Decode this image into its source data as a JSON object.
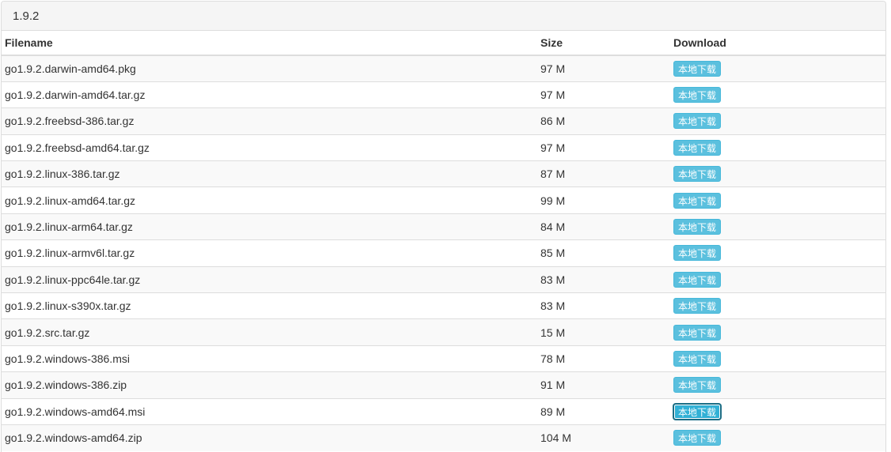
{
  "panel": {
    "title": "1.9.2"
  },
  "table": {
    "headers": {
      "filename": "Filename",
      "size": "Size",
      "download": "Download"
    },
    "rows": [
      {
        "filename": "go1.9.2.darwin-amd64.pkg",
        "size": "97 M",
        "download": "本地下载"
      },
      {
        "filename": "go1.9.2.darwin-amd64.tar.gz",
        "size": "97 M",
        "download": "本地下载"
      },
      {
        "filename": "go1.9.2.freebsd-386.tar.gz",
        "size": "86 M",
        "download": "本地下载"
      },
      {
        "filename": "go1.9.2.freebsd-amd64.tar.gz",
        "size": "97 M",
        "download": "本地下载"
      },
      {
        "filename": "go1.9.2.linux-386.tar.gz",
        "size": "87 M",
        "download": "本地下载"
      },
      {
        "filename": "go1.9.2.linux-amd64.tar.gz",
        "size": "99 M",
        "download": "本地下载"
      },
      {
        "filename": "go1.9.2.linux-arm64.tar.gz",
        "size": "84 M",
        "download": "本地下载"
      },
      {
        "filename": "go1.9.2.linux-armv6l.tar.gz",
        "size": "85 M",
        "download": "本地下载"
      },
      {
        "filename": "go1.9.2.linux-ppc64le.tar.gz",
        "size": "83 M",
        "download": "本地下载"
      },
      {
        "filename": "go1.9.2.linux-s390x.tar.gz",
        "size": "83 M",
        "download": "本地下载"
      },
      {
        "filename": "go1.9.2.src.tar.gz",
        "size": "15 M",
        "download": "本地下载"
      },
      {
        "filename": "go1.9.2.windows-386.msi",
        "size": "78 M",
        "download": "本地下载"
      },
      {
        "filename": "go1.9.2.windows-386.zip",
        "size": "91 M",
        "download": "本地下载"
      },
      {
        "filename": "go1.9.2.windows-amd64.msi",
        "size": "89 M",
        "download": "本地下载"
      },
      {
        "filename": "go1.9.2.windows-amd64.zip",
        "size": "104 M",
        "download": "本地下载"
      }
    ]
  },
  "colors": {
    "button_bg": "#5bc0de",
    "stripe_bg": "#f9f9f9",
    "heading_bg": "#f5f5f5"
  }
}
